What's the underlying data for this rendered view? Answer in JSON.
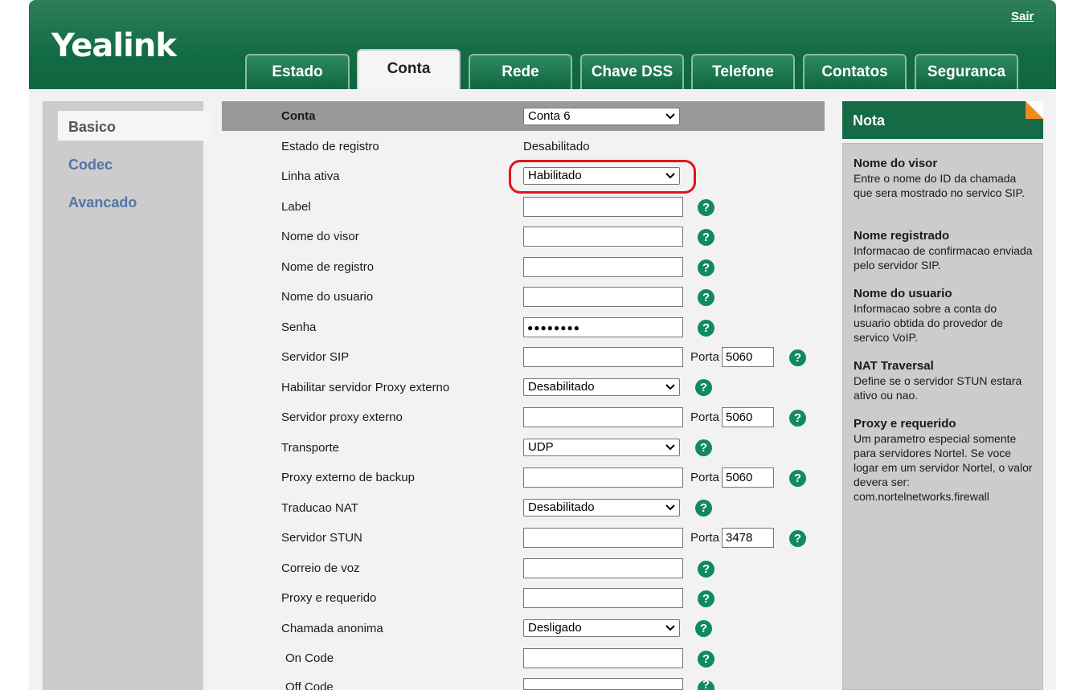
{
  "header": {
    "logo": "Yealink",
    "logout": "Sair",
    "tabs": [
      "Estado",
      "Conta",
      "Rede",
      "Chave DSS",
      "Telefone",
      "Contatos",
      "Seguranca"
    ],
    "active_tab": "Conta"
  },
  "sidebar": {
    "items": [
      "Basico",
      "Codec",
      "Avancado"
    ],
    "active": "Basico"
  },
  "form": {
    "conta_label": "Conta",
    "conta_value": "Conta 6",
    "estado_label": "Estado de registro",
    "estado_value": "Desabilitado",
    "linha_label": "Linha ativa",
    "linha_value": "Habilitado",
    "label_label": "Label",
    "label_value": "",
    "visor_label": "Nome do visor",
    "visor_value": "",
    "registro_label": "Nome de registro",
    "registro_value": "",
    "usuario_label": "Nome do usuario",
    "usuario_value": "",
    "senha_label": "Senha",
    "senha_value": "●●●●●●●●",
    "sip_label": "Servidor SIP",
    "sip_value": "",
    "porta_label": "Porta",
    "sip_port": "5060",
    "proxy_enable_label": "Habilitar servidor Proxy externo",
    "proxy_enable_value": "Desabilitado",
    "proxy_label": "Servidor proxy externo",
    "proxy_value": "",
    "proxy_port": "5060",
    "transporte_label": "Transporte",
    "transporte_value": "UDP",
    "backup_label": "Proxy externo de backup",
    "backup_value": "",
    "backup_port": "5060",
    "nat_label": "Traducao NAT",
    "nat_value": "Desabilitado",
    "stun_label": "Servidor STUN",
    "stun_value": "",
    "stun_port": "3478",
    "voz_label": "Correio de voz",
    "voz_value": "",
    "proxy_req_label": "Proxy e requerido",
    "proxy_req_value": "",
    "anonima_label": "Chamada anonima",
    "anonima_value": "Desligado",
    "on_code_label": "On Code",
    "on_code_value": "",
    "off_code_label": "Off Code",
    "off_code_value": "",
    "help_glyph": "?"
  },
  "nota": {
    "title": "Nota",
    "notes": [
      {
        "title": "Nome do visor",
        "text": "Entre o nome do ID da chamada que sera mostrado no servico SIP."
      },
      {
        "title": "Nome registrado",
        "text": "Informacao de confirmacao enviada pelo servidor SIP."
      },
      {
        "title": "Nome do usuario",
        "text": "Informacao sobre a conta do usuario obtida do provedor de servico VoIP."
      },
      {
        "title": "NAT Traversal",
        "text": "Define se o servidor STUN estara ativo ou nao."
      },
      {
        "title": "Proxy e requerido",
        "text": "Um parametro especial somente para servidores Nortel. Se voce logar em um servidor Nortel, o valor devera ser: com.nortelnetworks.firewall"
      }
    ]
  },
  "colors": {
    "header_green": "#146b45",
    "help_green": "#0f8a62",
    "sidebar_link": "#5474a8",
    "highlight_red": "#e0151b",
    "nota_corner": "#f08a1c"
  },
  "icons": {
    "help": "help-icon",
    "dropdown": "chevron-down-icon"
  }
}
